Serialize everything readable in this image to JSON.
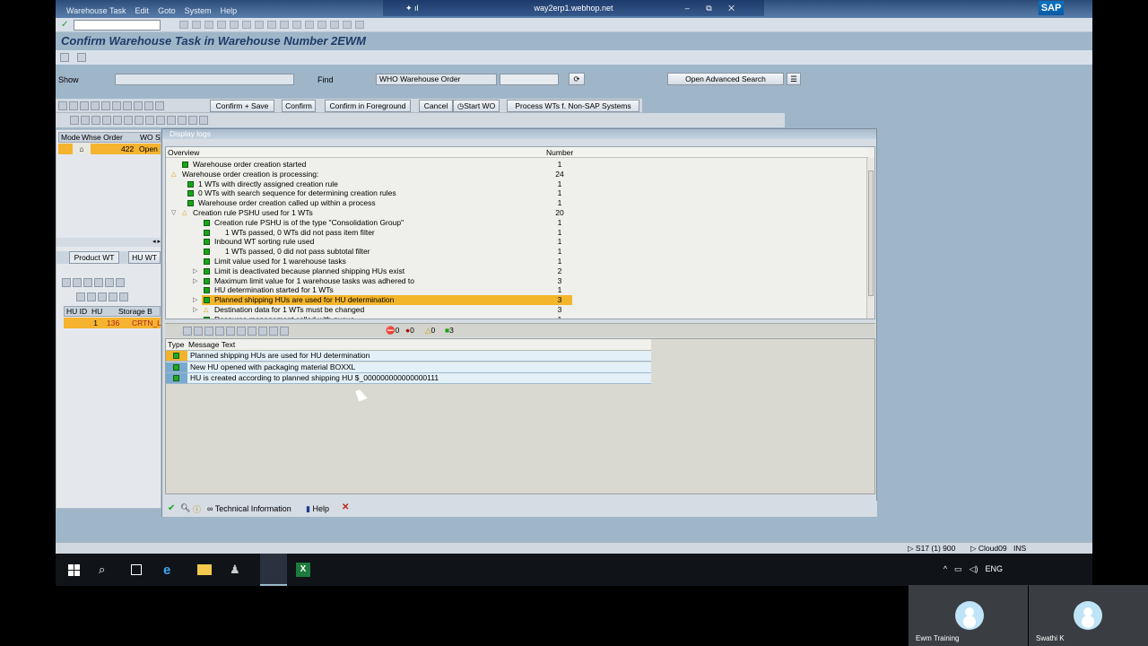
{
  "window": {
    "menu": [
      "Warehouse Task",
      "Edit",
      "Goto",
      "System",
      "Help"
    ],
    "remote_host": "way2erp1.webhop.net",
    "brand": "SAP"
  },
  "page_title": "Confirm Warehouse Task in Warehouse Number 2EWM",
  "search": {
    "show_label": "Show",
    "show_value": "",
    "find_label": "Find",
    "find_value": "WHO Warehouse Order",
    "advanced_button": "Open Advanced Search"
  },
  "toolbar": {
    "confirm_save": "Confirm + Save",
    "confirm": "Confirm",
    "confirm_foreground": "Confirm in Foreground",
    "cancel": "Cancel",
    "start_wo": "Start WO",
    "process_wts": "Process WTs f. Non-SAP Systems"
  },
  "left_grid": {
    "headers": [
      "Mode",
      "Whse Order",
      "WO S"
    ],
    "row": {
      "whse_order": "422",
      "status": "Open"
    },
    "tabs": [
      "Product WT",
      "HU WT"
    ],
    "hu_headers": [
      "HU ID",
      "HU",
      "Storage B"
    ],
    "hu_row": {
      "hu_id": "1",
      "hu": "136",
      "storage": "CRTN_LAI"
    }
  },
  "dialog": {
    "title": "Display logs",
    "overview_header": "Overview",
    "number_header": "Number",
    "tree": [
      {
        "text": "Warehouse order creation started",
        "num": "1",
        "level": 1,
        "icon": "green"
      },
      {
        "text": "Warehouse order creation is processing:",
        "num": "24",
        "level": 0,
        "icon": "warn",
        "expanded": true
      },
      {
        "text": "1 WTs with directly assigned creation rule",
        "num": "1",
        "level": 2,
        "icon": "green"
      },
      {
        "text": "0 WTs with search sequence for determining creation rules",
        "num": "1",
        "level": 2,
        "icon": "green"
      },
      {
        "text": "Warehouse order creation called up within a process",
        "num": "1",
        "level": 2,
        "icon": "green",
        "indent_alt": true
      },
      {
        "text": "Creation rule PSHU used for      1 WTs",
        "num": "20",
        "level": 1,
        "icon": "warn",
        "expanded": true
      },
      {
        "text": "Creation rule PSHU is of the type \"Consolidation Group\"",
        "num": "1",
        "level": 3,
        "icon": "green"
      },
      {
        "text": "1 WTs passed,      0 WTs did not pass item filter",
        "num": "1",
        "level": 3,
        "icon": "green",
        "extra_indent": true
      },
      {
        "text": "Inbound WT sorting rule  used",
        "num": "1",
        "level": 3,
        "icon": "green"
      },
      {
        "text": "1 WTs passed,      0 did not pass subtotal filter",
        "num": "1",
        "level": 3,
        "icon": "green",
        "extra_indent": true
      },
      {
        "text": "Limit value  used for      1 warehouse tasks",
        "num": "1",
        "level": 3,
        "icon": "green"
      },
      {
        "text": "Limit  is deactivated because planned shipping HUs exist",
        "num": "2",
        "level": 3,
        "icon": "green",
        "collapsed": true
      },
      {
        "text": "Maximum limit value for 1 warehouse tasks was adhered to",
        "num": "3",
        "level": 3,
        "icon": "green",
        "collapsed": true
      },
      {
        "text": "HU determination started for 1 WTs",
        "num": "1",
        "level": 3,
        "icon": "green"
      },
      {
        "text": "Planned shipping HUs are used for HU determination",
        "num": "3",
        "level": 3,
        "icon": "green",
        "collapsed": true,
        "selected": true
      },
      {
        "text": "Destination data for 1 WTs must be changed",
        "num": "3",
        "level": 3,
        "icon": "warn",
        "collapsed": true
      },
      {
        "text": "Resource management called with queue",
        "num": "1",
        "level": 3,
        "icon": "green"
      }
    ],
    "counters": {
      "red_stop": "0",
      "red": "0",
      "yellow": "0",
      "green": "3"
    },
    "msg_headers": {
      "type": "Type",
      "text": "Message Text"
    },
    "messages": [
      {
        "text": "Planned shipping HUs are used for HU determination",
        "type": "warn"
      },
      {
        "text": "New HU opened with packaging material BOXXL",
        "type": "info"
      },
      {
        "text": "HU is created according to planned shipping HU $_000000000000000111",
        "type": "info"
      }
    ],
    "footer": {
      "technical": "Technical Information",
      "help": "Help"
    }
  },
  "status": {
    "session": "S17 (1) 900",
    "server": "Cloud09",
    "mode": "INS"
  },
  "taskbar": {
    "lang": "ENG"
  },
  "participants": [
    "Ewm Training",
    "Swathi K"
  ]
}
